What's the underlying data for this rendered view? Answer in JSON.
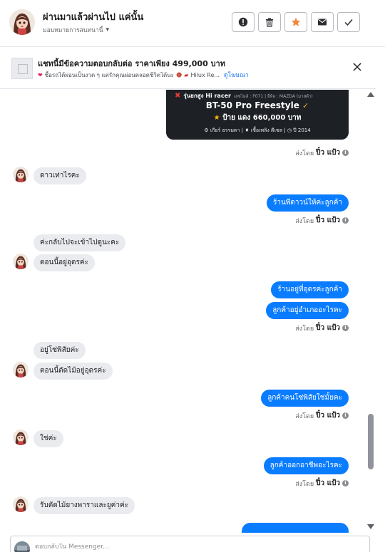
{
  "header": {
    "title": "ผ่านมาแล้วผ่านไป แค่นั้น",
    "subtitle": "มอบหมายการสนทนานี้",
    "actions": [
      "alert-icon",
      "trash-icon",
      "star-icon",
      "mail-icon",
      "check-icon"
    ],
    "star_color": "#f0883e"
  },
  "ad": {
    "title": "แชทนี้มีข้อความตอบกลับต่อ ราคาเพียง 499,000 บาท",
    "line_part1": "ซื้อรถได้ผ่อนเป็นงวด ๆ แต่รักคุณผ่อนตลอดชีวิตได้นะ",
    "line_part2": "Hilux Re...",
    "link": "ดูโฆษณา"
  },
  "car_card": {
    "line1_title": "รุ่นยกสูง Hi racer",
    "line1_meta": "เลขไมล์ : F071 | ยี่ห้อ : MAZDA (มาสด้า)",
    "model": "BT-50 Pro Freestyle",
    "price": "ป้าย แดง 660,000 บาท",
    "gear": "เกียร์ ธรรมดา",
    "fuel": "เชื้อเพลิง ดีเซล",
    "year": "ปี 2014"
  },
  "sender_label": "ส่งโดย",
  "sender_name": "ปิ๋ว แป้ว",
  "messages": [
    {
      "dir": "in",
      "text": "ดาวเท่าไรคะ"
    },
    {
      "dir": "out",
      "text": "ร้านพีดาวน์ให้ค่ะลูกค้า"
    },
    {
      "dir": "in",
      "text": "ค่ะกลับไปจะเข้าไปดูนะคะ"
    },
    {
      "dir": "in",
      "text": "ตอนนี้อยู่อุดรค่ะ"
    },
    {
      "dir": "out",
      "text": "ร้านอยู่ที่อุดรค่ะลูกค้า"
    },
    {
      "dir": "out",
      "text": "ลูกค้าอยู่อำเภออะไรคะ"
    },
    {
      "dir": "in",
      "text": "อยู่โซ่พิสัยค่ะ"
    },
    {
      "dir": "in",
      "text": "ตอนนี้ตัดไม้อยู่อุดรค่ะ"
    },
    {
      "dir": "out",
      "text": "ลูกค้าคนโซ่พิสัยใช่มั้ยคะ"
    },
    {
      "dir": "in",
      "text": "ใช่ค่ะ"
    },
    {
      "dir": "out",
      "text": "ลูกค้าออกอาชีพอะไรคะ"
    },
    {
      "dir": "in",
      "text": "รับตัดไม้ยางพาราและยูค่าค่ะ"
    }
  ],
  "composer": {
    "placeholder": "ตอบกลับใน Messenger..."
  },
  "colors": {
    "outgoing_bubble": "#0a7cff",
    "incoming_bubble": "#e9ebee",
    "link": "#1877f2"
  }
}
